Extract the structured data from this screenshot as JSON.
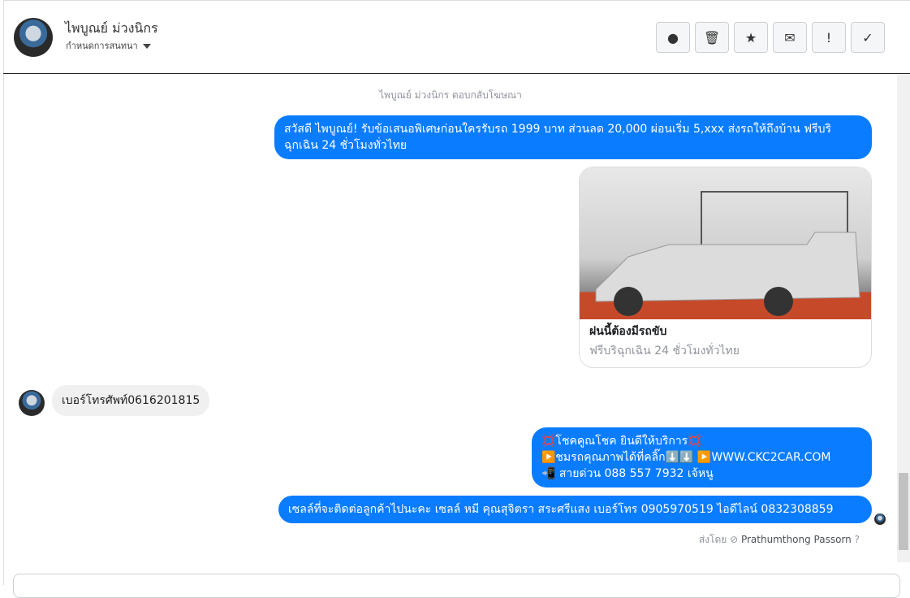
{
  "header": {
    "name": "ไพบูณย์ ม่วงนิกร",
    "subtitle": "กำหนดการสนทนา",
    "actions": [
      {
        "icon": "alert-circle-icon",
        "glyph": "❗"
      },
      {
        "icon": "trash-icon",
        "glyph": "🗑"
      },
      {
        "icon": "star-icon",
        "glyph": "★"
      },
      {
        "icon": "mail-icon",
        "glyph": "✉"
      },
      {
        "icon": "exclamation-icon",
        "glyph": "!"
      },
      {
        "icon": "check-icon",
        "glyph": "✓"
      }
    ]
  },
  "chat": {
    "notice": "ไพบูณย์ ม่วงนิกร ตอบกลับโฆษณา",
    "ad_message_1": "สวัสดี ไพบูณย์! รับข้อเสนอพิเศษก่อนใครรับรถ 1999 บาท ส่วนลด 20,000  ผ่อนเริ่ม 5,xxx ส่งรถให้ถึงบ้าน ฟรีบริ",
    "ad_message_2": "ฉุกเฉิน 24 ชั่วโมงทั่วไทย",
    "card": {
      "title": "ฝนนี้ต้องมีรถขับ",
      "desc": "ฟรีบริฉุกเฉิน 24 ชั่วโมงทั่วไทย"
    },
    "incoming": "เบอร์โทรศัพท์0616201815",
    "reply": {
      "line1": "💢โชคคูณโชค ยินดีให้บริการ💢",
      "line2": "▶️ชมรถคุณภาพได้ที่คลิ๊ก⬇️⬇️      ▶️",
      "link": "WWW.CKC2CAR.COM",
      "line3": "📲 สายด่วน 088 557 7932 เจ้หนู"
    },
    "reply2": "เซลล์ที่จะติดต่อลูกค้าไปนะคะ เซลล์ หมี คุณสุจิตรา สระศรีแสง เบอร์โทร 0905970519 ไอดีไลน์ 0832308859",
    "sent_by_label": "ส่งโดย",
    "sent_by_name": "Prathumthong Passorn"
  }
}
